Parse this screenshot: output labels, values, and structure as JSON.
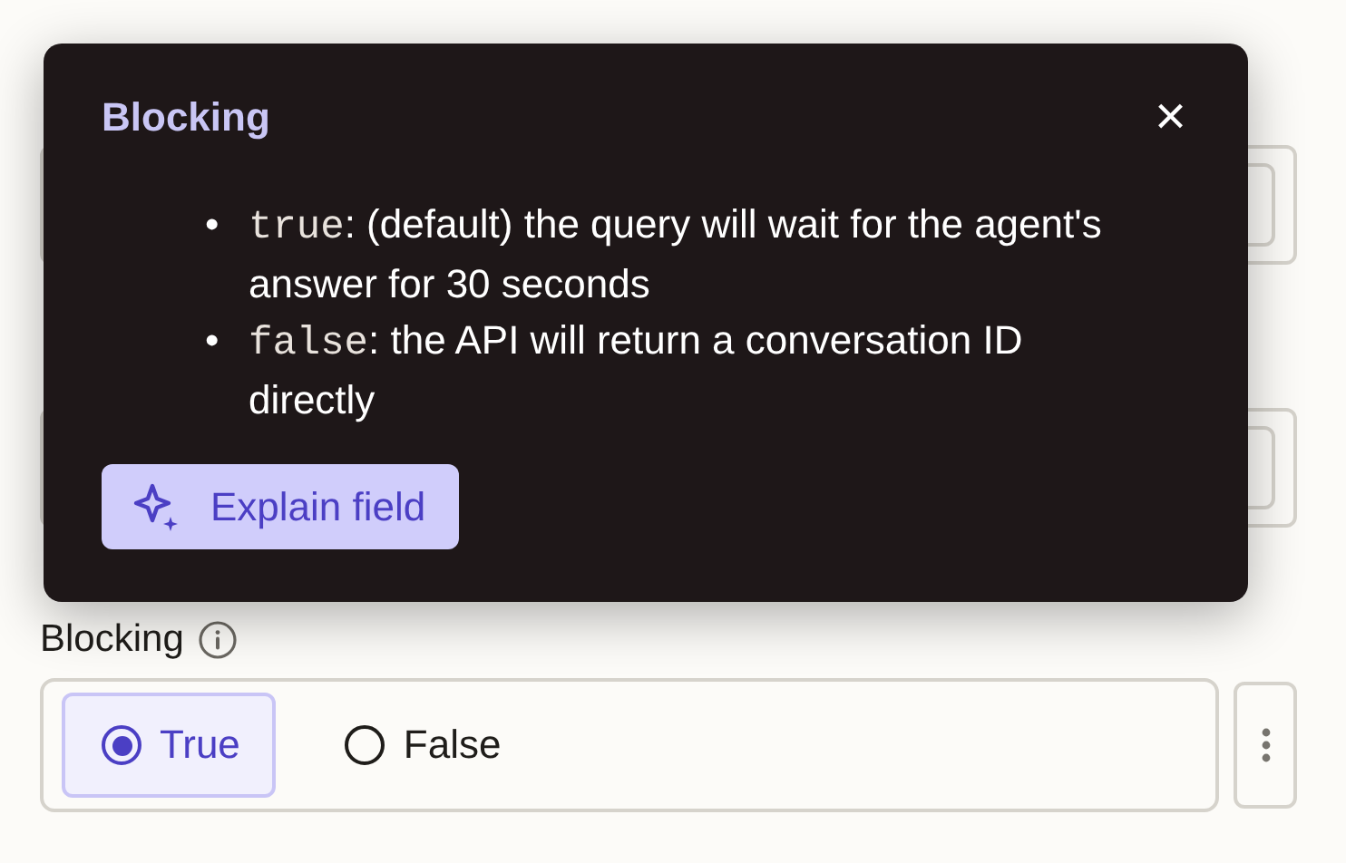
{
  "popover": {
    "title": "Blocking",
    "close": "×",
    "items": [
      {
        "bullet": "•",
        "code": "true",
        "text": ": (default) the query will wait for the agent's answer for 30 seconds"
      },
      {
        "bullet": "•",
        "code": "false",
        "text": ": the API will return a conversation ID directly"
      }
    ],
    "button": "Explain field"
  },
  "field": {
    "label": "Blocking",
    "options": [
      {
        "label": "True",
        "selected": true
      },
      {
        "label": "False",
        "selected": false
      }
    ]
  }
}
